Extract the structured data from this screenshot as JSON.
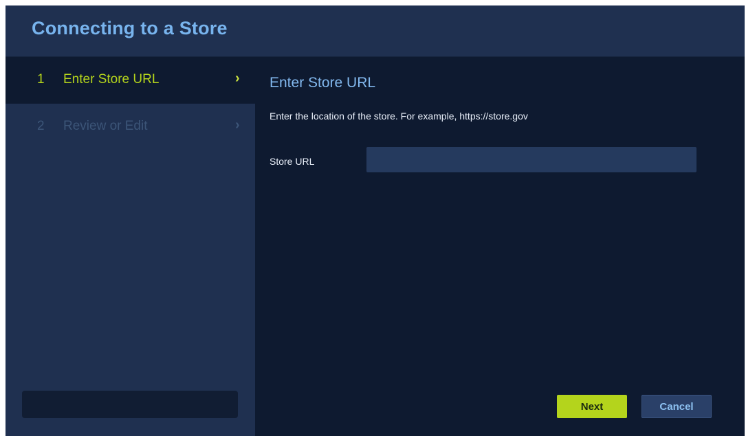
{
  "dialog": {
    "title": "Connecting to a Store"
  },
  "steps": [
    {
      "number": "1",
      "label": "Enter Store URL",
      "chevron": "›",
      "state": "active"
    },
    {
      "number": "2",
      "label": "Review or Edit",
      "chevron": "›",
      "state": "inactive"
    }
  ],
  "main": {
    "heading": "Enter Store URL",
    "description": "Enter the location of the store. For example, https://store.gov",
    "store_url": {
      "label": "Store URL",
      "value": "",
      "placeholder": ""
    }
  },
  "buttons": {
    "next_label": "Next",
    "cancel_label": "Cancel"
  },
  "colors": {
    "background": "#0e1a30",
    "panel": "#1f3050",
    "accent_green": "#b4d41c",
    "accent_blue": "#78b4ee"
  }
}
